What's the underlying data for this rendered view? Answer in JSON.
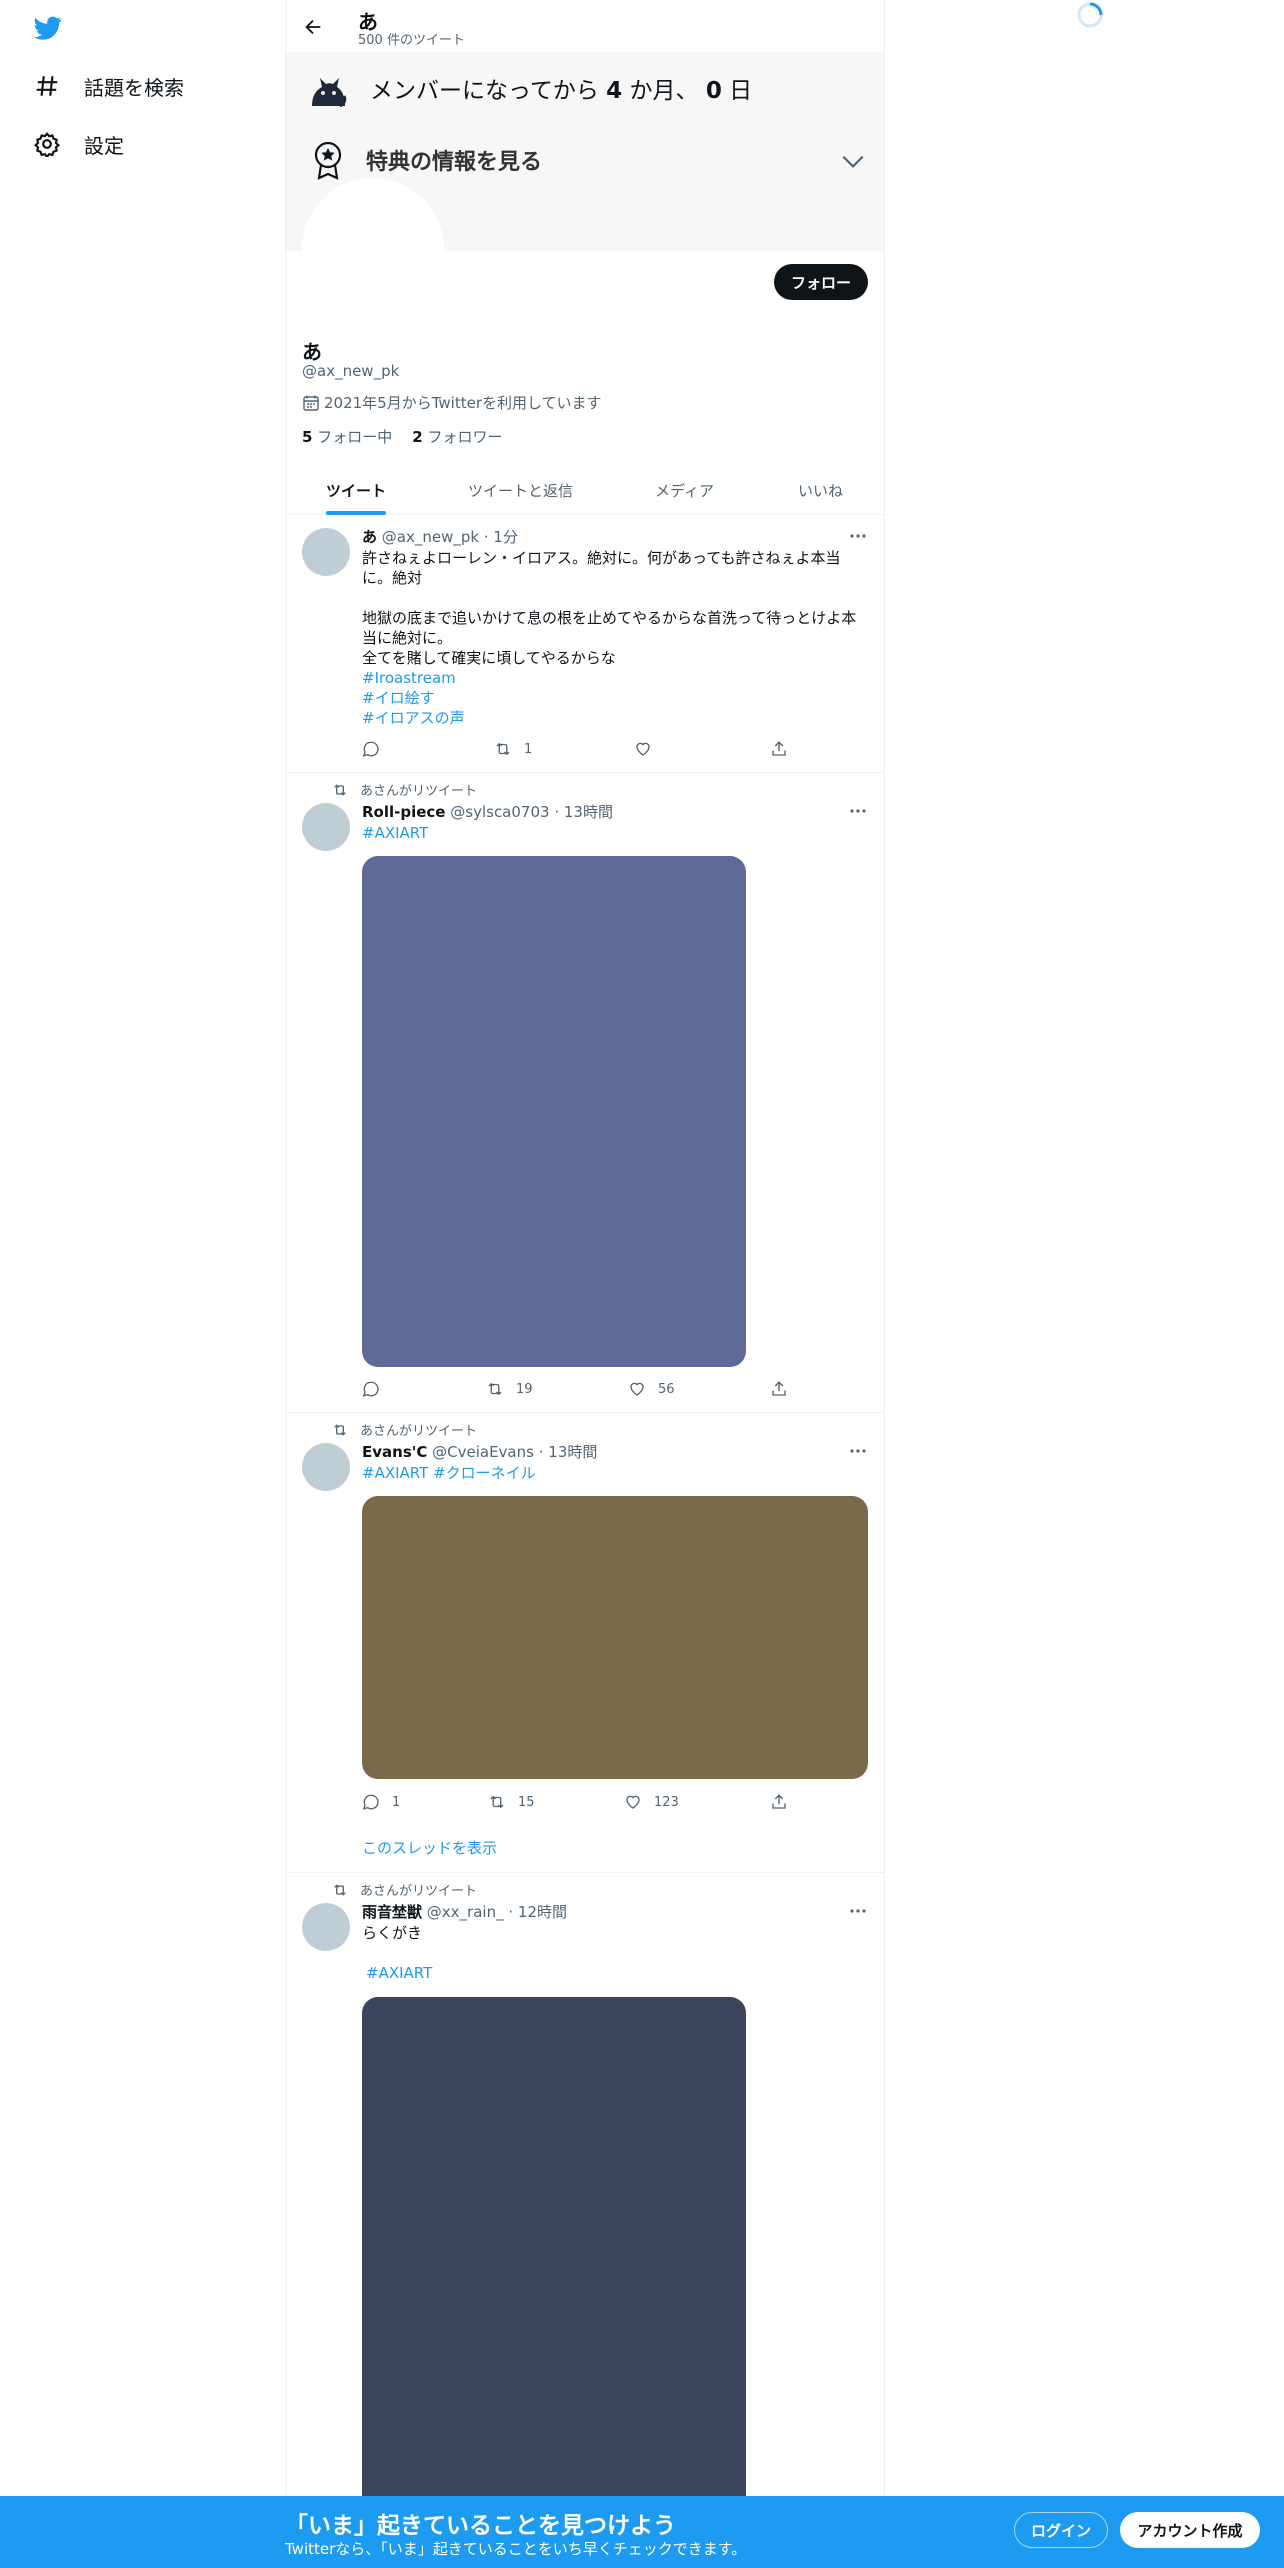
{
  "sidebar": {
    "logo": "twitter-bird-icon",
    "items": [
      {
        "icon": "hashtag-icon",
        "label": "話題を検索"
      },
      {
        "icon": "gear-icon",
        "label": "設定"
      }
    ]
  },
  "header": {
    "name": "あ",
    "tweet_count": "500 件のツイート"
  },
  "banner": {
    "member_prefix": "メンバーになってから",
    "months": "4",
    "month_unit": "か月、",
    "days": "0",
    "day_unit": "日",
    "perks_label": "特典の情報を見る"
  },
  "profile": {
    "follow_label": "フォロー",
    "name": "あ",
    "handle": "@ax_new_pk",
    "joined": "2021年5月からTwitterを利用しています",
    "following_count": "5",
    "following_label": "フォロー中",
    "followers_count": "2",
    "followers_label": "フォロワー"
  },
  "tabs": [
    "ツイート",
    "ツイートと返信",
    "メディア",
    "いいね"
  ],
  "tweets": [
    {
      "name": "あ",
      "handle": "@ax_new_pk",
      "time": "1分",
      "line1": "許さねぇよローレン・イロアス。絶対に。何があっても許さねぇよ本当",
      "line2": "に。絶対",
      "line3": "地獄の底まで追いかけて息の根を止めてやるからな首洗って待っとけよ本",
      "line4": "当に絶対に。",
      "line5": "全てを賭して確実に頃してやるからな",
      "tags": [
        "#Iroastream",
        "#イロ絵す",
        "#イロアスの声"
      ],
      "reply": "",
      "retweet": "1",
      "like": ""
    },
    {
      "retweeted_by": "あさんがリツイート",
      "name": "Roll-piece",
      "handle": "@sylsca0703",
      "time": "13時間",
      "tag": "#AXIART",
      "media_color": "#5f6a97",
      "reply": "",
      "retweet": "19",
      "like": "56"
    },
    {
      "retweeted_by": "あさんがリツイート",
      "name": "Evans'C",
      "handle": "@CveiaEvans",
      "time": "13時間",
      "tag1": "#AXIART",
      "tag2": "#クローネイル",
      "media_color": "#7b6a4a",
      "reply": "1",
      "retweet": "15",
      "like": "123",
      "thread": "このスレッドを表示"
    },
    {
      "retweeted_by": "あさんがリツイート",
      "name": "雨音埜獣",
      "handle": "@xx_rain_",
      "time": "12時間",
      "text": "らくがき",
      "tag": "#AXIART",
      "media_color": "#3c445b"
    }
  ],
  "bottom": {
    "title": "「いま」起きていることを見つけよう",
    "subtitle": "Twitterなら、「いま」起きていることをいち早くチェックできます。",
    "login": "ログイン",
    "signup": "アカウント作成"
  },
  "colors": {
    "accent": "#1d9bf0",
    "dark": "#0f1419",
    "muted": "#536471"
  }
}
